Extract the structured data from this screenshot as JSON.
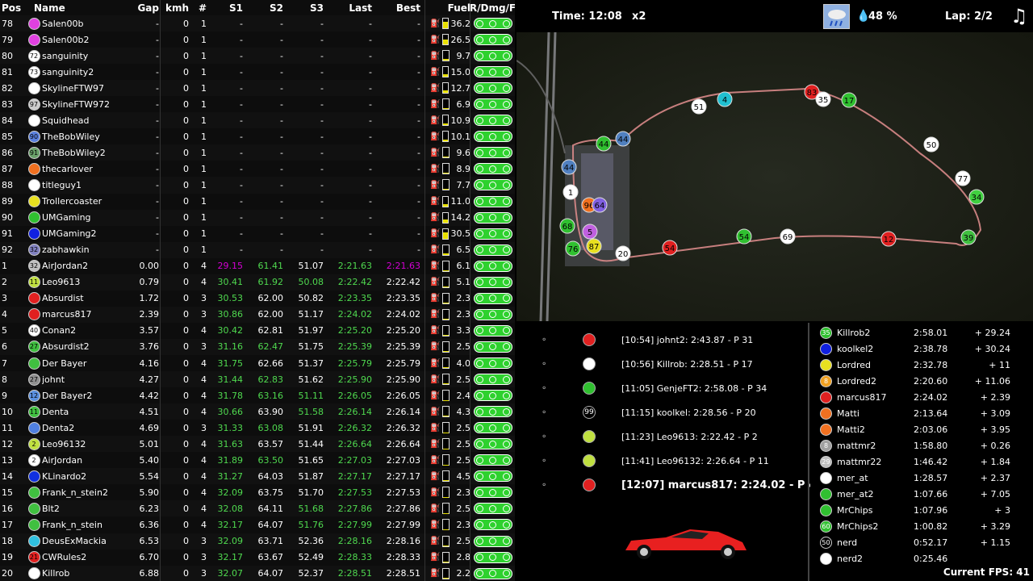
{
  "headers": {
    "pos": "Pos",
    "name": "Name",
    "gap": "Gap",
    "kmh": "kmh",
    "num": "#",
    "s1": "S1",
    "s2": "S2",
    "s3": "S3",
    "last": "Last",
    "best": "Best",
    "fuel": "Fuel",
    "rdf": "R/Dmg/F"
  },
  "rows": [
    {
      "pos": "78",
      "avatar": "",
      "color": "#e040e0",
      "name": "Salen00b",
      "gap": "-",
      "kmh": "0",
      "num": "1",
      "s1": "-",
      "s2": "-",
      "s3": "-",
      "last": "-",
      "best": "-",
      "fuel": "36.2",
      "fuel_level": 0.7
    },
    {
      "pos": "79",
      "avatar": "",
      "color": "#e040e0",
      "name": "Salen00b2",
      "gap": "-",
      "kmh": "0",
      "num": "1",
      "s1": "-",
      "s2": "-",
      "s3": "-",
      "last": "-",
      "best": "-",
      "fuel": "26.5",
      "fuel_level": 0.5
    },
    {
      "pos": "80",
      "avatar": "72",
      "color": "#ffffff",
      "name": "sanguinity",
      "gap": "-",
      "kmh": "0",
      "num": "1",
      "s1": "-",
      "s2": "-",
      "s3": "-",
      "last": "-",
      "best": "-",
      "fuel": "9.7",
      "fuel_level": 0.15
    },
    {
      "pos": "81",
      "avatar": "73",
      "color": "#ffffff",
      "name": "sanguinity2",
      "gap": "-",
      "kmh": "0",
      "num": "1",
      "s1": "-",
      "s2": "-",
      "s3": "-",
      "last": "-",
      "best": "-",
      "fuel": "15.0",
      "fuel_level": 0.3
    },
    {
      "pos": "82",
      "avatar": "",
      "color": "#ffffff",
      "name": "SkylineFTW97",
      "gap": "-",
      "kmh": "0",
      "num": "1",
      "s1": "-",
      "s2": "-",
      "s3": "-",
      "last": "-",
      "best": "-",
      "fuel": "12.7",
      "fuel_level": 0.25
    },
    {
      "pos": "83",
      "avatar": "97",
      "color": "#cccccc",
      "name": "SkylineFTW972",
      "gap": "-",
      "kmh": "0",
      "num": "1",
      "s1": "-",
      "s2": "-",
      "s3": "-",
      "last": "-",
      "best": "-",
      "fuel": "6.9",
      "fuel_level": 0.1
    },
    {
      "pos": "84",
      "avatar": "",
      "color": "#ffffff",
      "name": "Squidhead",
      "gap": "-",
      "kmh": "0",
      "num": "1",
      "s1": "-",
      "s2": "-",
      "s3": "-",
      "last": "-",
      "best": "-",
      "fuel": "10.9",
      "fuel_level": 0.2
    },
    {
      "pos": "85",
      "avatar": "90",
      "color": "#5a80e0",
      "name": "TheBobWiley",
      "gap": "-",
      "kmh": "0",
      "num": "1",
      "s1": "-",
      "s2": "-",
      "s3": "-",
      "last": "-",
      "best": "-",
      "fuel": "10.1",
      "fuel_level": 0.2
    },
    {
      "pos": "86",
      "avatar": "91",
      "color": "#6aa06a",
      "name": "TheBobWiley2",
      "gap": "-",
      "kmh": "0",
      "num": "1",
      "s1": "-",
      "s2": "-",
      "s3": "-",
      "last": "-",
      "best": "-",
      "fuel": "9.6",
      "fuel_level": 0.15
    },
    {
      "pos": "87",
      "avatar": "",
      "color": "#f07020",
      "name": "thecarlover",
      "gap": "-",
      "kmh": "0",
      "num": "1",
      "s1": "-",
      "s2": "-",
      "s3": "-",
      "last": "-",
      "best": "-",
      "fuel": "8.9",
      "fuel_level": 0.15
    },
    {
      "pos": "88",
      "avatar": "",
      "color": "#ffffff",
      "name": "titleguy1",
      "gap": "-",
      "kmh": "0",
      "num": "1",
      "s1": "-",
      "s2": "-",
      "s3": "-",
      "last": "-",
      "best": "-",
      "fuel": "7.7",
      "fuel_level": 0.1
    },
    {
      "pos": "89",
      "avatar": "",
      "color": "#e8e020",
      "name": "Trollercoaster",
      "gap": "-",
      "kmh": "0",
      "num": "1",
      "s1": "-",
      "s2": "-",
      "s3": "-",
      "last": "-",
      "best": "-",
      "fuel": "11.0",
      "fuel_level": 0.2
    },
    {
      "pos": "90",
      "avatar": "",
      "color": "#30c030",
      "name": "UMGaming",
      "gap": "-",
      "kmh": "0",
      "num": "1",
      "s1": "-",
      "s2": "-",
      "s3": "-",
      "last": "-",
      "best": "-",
      "fuel": "14.2",
      "fuel_level": 0.3
    },
    {
      "pos": "91",
      "avatar": "",
      "color": "#1020e0",
      "name": "UMGaming2",
      "gap": "-",
      "kmh": "0",
      "num": "1",
      "s1": "-",
      "s2": "-",
      "s3": "-",
      "last": "-",
      "best": "-",
      "fuel": "30.5",
      "fuel_level": 0.6
    },
    {
      "pos": "92",
      "avatar": "32",
      "color": "#8080c0",
      "name": "zabhawkin",
      "gap": "-",
      "kmh": "0",
      "num": "1",
      "s1": "-",
      "s2": "-",
      "s3": "-",
      "last": "-",
      "best": "-",
      "fuel": "6.5",
      "fuel_level": 0.1
    },
    {
      "pos": "1",
      "avatar": "32",
      "color": "#c0c0c0",
      "name": "AirJordan2",
      "gap": "0.00",
      "kmh": "0",
      "num": "4",
      "s1": "29.15",
      "s2": "61.41",
      "s3": "51.07",
      "last": "2:21.63",
      "best": "2:21.63",
      "fuel": "6.1",
      "fuel_level": 0.1,
      "s1c": "purple",
      "s2c": "green",
      "lastc": "green",
      "bestc": "purple"
    },
    {
      "pos": "2",
      "avatar": "11",
      "color": "#c0e040",
      "name": "Leo9613",
      "gap": "0.79",
      "kmh": "0",
      "num": "4",
      "s1": "30.41",
      "s2": "61.92",
      "s3": "50.08",
      "last": "2:22.42",
      "best": "2:22.42",
      "fuel": "5.1",
      "fuel_level": 0.1,
      "s1c": "green",
      "s2c": "green",
      "s3c": "green",
      "lastc": "green"
    },
    {
      "pos": "3",
      "avatar": "",
      "color": "#e02020",
      "name": "Absurdist",
      "gap": "1.72",
      "kmh": "0",
      "num": "3",
      "s1": "30.53",
      "s2": "62.00",
      "s3": "50.82",
      "last": "2:23.35",
      "best": "2:23.35",
      "fuel": "2.3",
      "fuel_level": 0.05,
      "s1c": "green",
      "lastc": "green"
    },
    {
      "pos": "4",
      "avatar": "",
      "color": "#e02020",
      "name": "marcus817",
      "gap": "2.39",
      "kmh": "0",
      "num": "3",
      "s1": "30.86",
      "s2": "62.00",
      "s3": "51.17",
      "last": "2:24.02",
      "best": "2:24.02",
      "fuel": "2.3",
      "fuel_level": 0.05,
      "s1c": "green",
      "lastc": "green"
    },
    {
      "pos": "5",
      "avatar": "40",
      "color": "#ffffff",
      "name": "Conan2",
      "gap": "3.57",
      "kmh": "0",
      "num": "4",
      "s1": "30.42",
      "s2": "62.81",
      "s3": "51.97",
      "last": "2:25.20",
      "best": "2:25.20",
      "fuel": "3.3",
      "fuel_level": 0.05,
      "s1c": "green",
      "lastc": "green"
    },
    {
      "pos": "6",
      "avatar": "27",
      "color": "#40c040",
      "name": "Absurdist2",
      "gap": "3.76",
      "kmh": "0",
      "num": "3",
      "s1": "31.16",
      "s2": "62.47",
      "s3": "51.75",
      "last": "2:25.39",
      "best": "2:25.39",
      "fuel": "2.5",
      "fuel_level": 0.05,
      "s1c": "green",
      "s2c": "green",
      "lastc": "green"
    },
    {
      "pos": "7",
      "avatar": "",
      "color": "#40c040",
      "name": "Der Bayer",
      "gap": "4.16",
      "kmh": "0",
      "num": "4",
      "s1": "31.75",
      "s2": "62.66",
      "s3": "51.37",
      "last": "2:25.79",
      "best": "2:25.79",
      "fuel": "4.0",
      "fuel_level": 0.07,
      "s1c": "green",
      "lastc": "green"
    },
    {
      "pos": "8",
      "avatar": "27",
      "color": "#909090",
      "name": "johnt",
      "gap": "4.27",
      "kmh": "0",
      "num": "4",
      "s1": "31.44",
      "s2": "62.83",
      "s3": "51.62",
      "last": "2:25.90",
      "best": "2:25.90",
      "fuel": "2.5",
      "fuel_level": 0.05,
      "s1c": "green",
      "s2c": "green",
      "lastc": "green"
    },
    {
      "pos": "9",
      "avatar": "12",
      "color": "#5a90e0",
      "name": "Der Bayer2",
      "gap": "4.42",
      "kmh": "0",
      "num": "4",
      "s1": "31.78",
      "s2": "63.16",
      "s3": "51.11",
      "last": "2:26.05",
      "best": "2:26.05",
      "fuel": "2.4",
      "fuel_level": 0.05,
      "s1c": "green",
      "s2c": "green",
      "s3c": "green",
      "lastc": "green"
    },
    {
      "pos": "10",
      "avatar": "11",
      "color": "#40c040",
      "name": "Denta",
      "gap": "4.51",
      "kmh": "0",
      "num": "4",
      "s1": "30.66",
      "s2": "63.90",
      "s3": "51.58",
      "last": "2:26.14",
      "best": "2:26.14",
      "fuel": "4.3",
      "fuel_level": 0.07,
      "s1c": "green",
      "s3c": "green",
      "lastc": "green"
    },
    {
      "pos": "11",
      "avatar": "",
      "color": "#5080e0",
      "name": "Denta2",
      "gap": "4.69",
      "kmh": "0",
      "num": "3",
      "s1": "31.33",
      "s2": "63.08",
      "s3": "51.91",
      "last": "2:26.32",
      "best": "2:26.32",
      "fuel": "2.5",
      "fuel_level": 0.05,
      "s1c": "green",
      "s2c": "green",
      "lastc": "green"
    },
    {
      "pos": "12",
      "avatar": "2",
      "color": "#c0e040",
      "name": "Leo96132",
      "gap": "5.01",
      "kmh": "0",
      "num": "4",
      "s1": "31.63",
      "s2": "63.57",
      "s3": "51.44",
      "last": "2:26.64",
      "best": "2:26.64",
      "fuel": "2.5",
      "fuel_level": 0.05,
      "s1c": "green",
      "lastc": "green"
    },
    {
      "pos": "13",
      "avatar": "2",
      "color": "#ffffff",
      "name": "AirJordan",
      "gap": "5.40",
      "kmh": "0",
      "num": "4",
      "s1": "31.89",
      "s2": "63.50",
      "s3": "51.65",
      "last": "2:27.03",
      "best": "2:27.03",
      "fuel": "2.5",
      "fuel_level": 0.05,
      "s1c": "green",
      "s2c": "green",
      "lastc": "green"
    },
    {
      "pos": "14",
      "avatar": "",
      "color": "#1030e0",
      "name": "KLinardo2",
      "gap": "5.54",
      "kmh": "0",
      "num": "4",
      "s1": "31.27",
      "s2": "64.03",
      "s3": "51.87",
      "last": "2:27.17",
      "best": "2:27.17",
      "fuel": "4.5",
      "fuel_level": 0.08,
      "s1c": "green",
      "lastc": "green"
    },
    {
      "pos": "15",
      "avatar": "",
      "color": "#40c040",
      "name": "Frank_n_stein2",
      "gap": "5.90",
      "kmh": "0",
      "num": "4",
      "s1": "32.09",
      "s2": "63.75",
      "s3": "51.70",
      "last": "2:27.53",
      "best": "2:27.53",
      "fuel": "2.3",
      "fuel_level": 0.05,
      "s1c": "green",
      "lastc": "green"
    },
    {
      "pos": "16",
      "avatar": "",
      "color": "#40c040",
      "name": "Blt2",
      "gap": "6.23",
      "kmh": "0",
      "num": "4",
      "s1": "32.08",
      "s2": "64.11",
      "s3": "51.68",
      "last": "2:27.86",
      "best": "2:27.86",
      "fuel": "2.5",
      "fuel_level": 0.05,
      "s1c": "green",
      "s3c": "green",
      "lastc": "green"
    },
    {
      "pos": "17",
      "avatar": "",
      "color": "#40c040",
      "name": "Frank_n_stein",
      "gap": "6.36",
      "kmh": "0",
      "num": "4",
      "s1": "32.17",
      "s2": "64.07",
      "s3": "51.76",
      "last": "2:27.99",
      "best": "2:27.99",
      "fuel": "2.3",
      "fuel_level": 0.05,
      "s1c": "green",
      "s3c": "green",
      "lastc": "green"
    },
    {
      "pos": "18",
      "avatar": "",
      "color": "#30c0e0",
      "name": "DeusExMackia",
      "gap": "6.53",
      "kmh": "0",
      "num": "3",
      "s1": "32.09",
      "s2": "63.71",
      "s3": "52.36",
      "last": "2:28.16",
      "best": "2:28.16",
      "fuel": "2.5",
      "fuel_level": 0.05,
      "s1c": "green",
      "lastc": "green"
    },
    {
      "pos": "19",
      "avatar": "21",
      "color": "#e02020",
      "name": "CWRules2",
      "gap": "6.70",
      "kmh": "0",
      "num": "3",
      "s1": "32.17",
      "s2": "63.67",
      "s3": "52.49",
      "last": "2:28.33",
      "best": "2:28.33",
      "fuel": "2.8",
      "fuel_level": 0.05,
      "s1c": "green",
      "lastc": "green"
    },
    {
      "pos": "20",
      "avatar": "",
      "color": "#ffffff",
      "name": "Killrob",
      "gap": "6.88",
      "kmh": "0",
      "num": "3",
      "s1": "32.07",
      "s2": "64.07",
      "s3": "52.37",
      "last": "2:28.51",
      "best": "2:28.51",
      "fuel": "2.2",
      "fuel_level": 0.05,
      "s1c": "green",
      "lastc": "green"
    }
  ],
  "rdf_colors": {
    "ring": "#2ed12e"
  },
  "topbar": {
    "time": "Time: 12:08",
    "speed": "x2",
    "weather_icon": "rain-cloud-icon",
    "humidity": "48 %",
    "lap": "Lap: 2/2",
    "music_icon": "music-note-icon"
  },
  "map_markers": [
    {
      "label": "4",
      "color": "#20c0d0"
    },
    {
      "label": "51",
      "color": "#ffffff"
    },
    {
      "label": "83",
      "color": "#e02020"
    },
    {
      "label": "35",
      "color": "#ffffff"
    },
    {
      "label": "17",
      "color": "#30c030"
    },
    {
      "label": "44",
      "color": "#5080c0"
    },
    {
      "label": "44",
      "color": "#30c030"
    },
    {
      "label": "44",
      "color": "#5080c0"
    },
    {
      "label": "50",
      "color": "#ffffff"
    },
    {
      "label": "77",
      "color": "#ffffff"
    },
    {
      "label": "34",
      "color": "#40d040"
    },
    {
      "label": "39",
      "color": "#40c040"
    },
    {
      "label": "12",
      "color": "#e02020"
    },
    {
      "label": "54",
      "color": "#30c030"
    },
    {
      "label": "69",
      "color": "#ffffff"
    },
    {
      "label": "54",
      "color": "#e02020"
    },
    {
      "label": "1",
      "color": "#ffffff"
    },
    {
      "label": "96",
      "color": "#f07020"
    },
    {
      "label": "64",
      "color": "#8060e0"
    },
    {
      "label": "68",
      "color": "#30c030"
    },
    {
      "label": "5",
      "color": "#c060e0"
    },
    {
      "label": "87",
      "color": "#e8e020"
    },
    {
      "label": "76",
      "color": "#30c030"
    },
    {
      "label": "20",
      "color": "#ffffff"
    }
  ],
  "events": [
    {
      "text": "[10:54] johnt2: 2:43.87 - P 31",
      "color": "#e02020",
      "label": ""
    },
    {
      "text": "[10:56] Killrob: 2:28.51 - P 17",
      "color": "#ffffff",
      "label": ""
    },
    {
      "text": "[11:05] GenjeFT2: 2:58.08 - P 34",
      "color": "#30c030",
      "label": ""
    },
    {
      "text": "[11:15] koolkel: 2:28.56 - P 20",
      "color": "#000000",
      "label": "99"
    },
    {
      "text": "[11:23] Leo9613: 2:22.42 - P 2",
      "color": "#c0e040",
      "label": ""
    },
    {
      "text": "[11:41] Leo96132: 2:26.64 - P 11",
      "color": "#c0e040",
      "label": ""
    },
    {
      "text": "[12:07] marcus817: 2:24.02 - P 4",
      "color": "#e02020",
      "label": ""
    }
  ],
  "laps": [
    {
      "name": "Killrob2",
      "time": "2:58.01",
      "diff": "+ 29.24",
      "color": "#30c030",
      "label": "35"
    },
    {
      "name": "koolkel2",
      "time": "2:38.78",
      "diff": "+ 30.24",
      "color": "#1020e0",
      "label": ""
    },
    {
      "name": "Lordred",
      "time": "2:32.78",
      "diff": "+ 11",
      "color": "#e8e020",
      "label": ""
    },
    {
      "name": "Lordred2",
      "time": "2:20.60",
      "diff": "+ 11.06",
      "color": "#f0a020",
      "label": "8"
    },
    {
      "name": "marcus817",
      "time": "2:24.02",
      "diff": "+ 2.39",
      "color": "#e02020",
      "label": ""
    },
    {
      "name": "Matti",
      "time": "2:13.64",
      "diff": "+ 3.09",
      "color": "#f07020",
      "label": ""
    },
    {
      "name": "Matti2",
      "time": "2:03.06",
      "diff": "+ 3.95",
      "color": "#f07020",
      "label": ""
    },
    {
      "name": "mattmr2",
      "time": "1:58.80",
      "diff": "+ 0.26",
      "color": "#a0a0a0",
      "label": "8"
    },
    {
      "name": "mattmr22",
      "time": "1:46.42",
      "diff": "+ 1.84",
      "color": "#c0c0c0",
      "label": "29"
    },
    {
      "name": "mer_at",
      "time": "1:28.57",
      "diff": "+ 2.37",
      "color": "#ffffff",
      "label": ""
    },
    {
      "name": "mer_at2",
      "time": "1:07.66",
      "diff": "+ 7.05",
      "color": "#30c030",
      "label": ""
    },
    {
      "name": "MrChips",
      "time": "1:07.96",
      "diff": "+ 3",
      "color": "#30c030",
      "label": ""
    },
    {
      "name": "MrChips2",
      "time": "1:00.82",
      "diff": "+ 3.29",
      "color": "#30c030",
      "label": "60"
    },
    {
      "name": "nerd",
      "time": "0:52.17",
      "diff": "+ 1.15",
      "color": "#000000",
      "label": "50"
    },
    {
      "name": "nerd2",
      "time": "0:25.46",
      "diff": "",
      "color": "#ffffff",
      "label": ""
    }
  ],
  "fps": "Current FPS: 41",
  "car_icon": "red-sports-car-icon"
}
